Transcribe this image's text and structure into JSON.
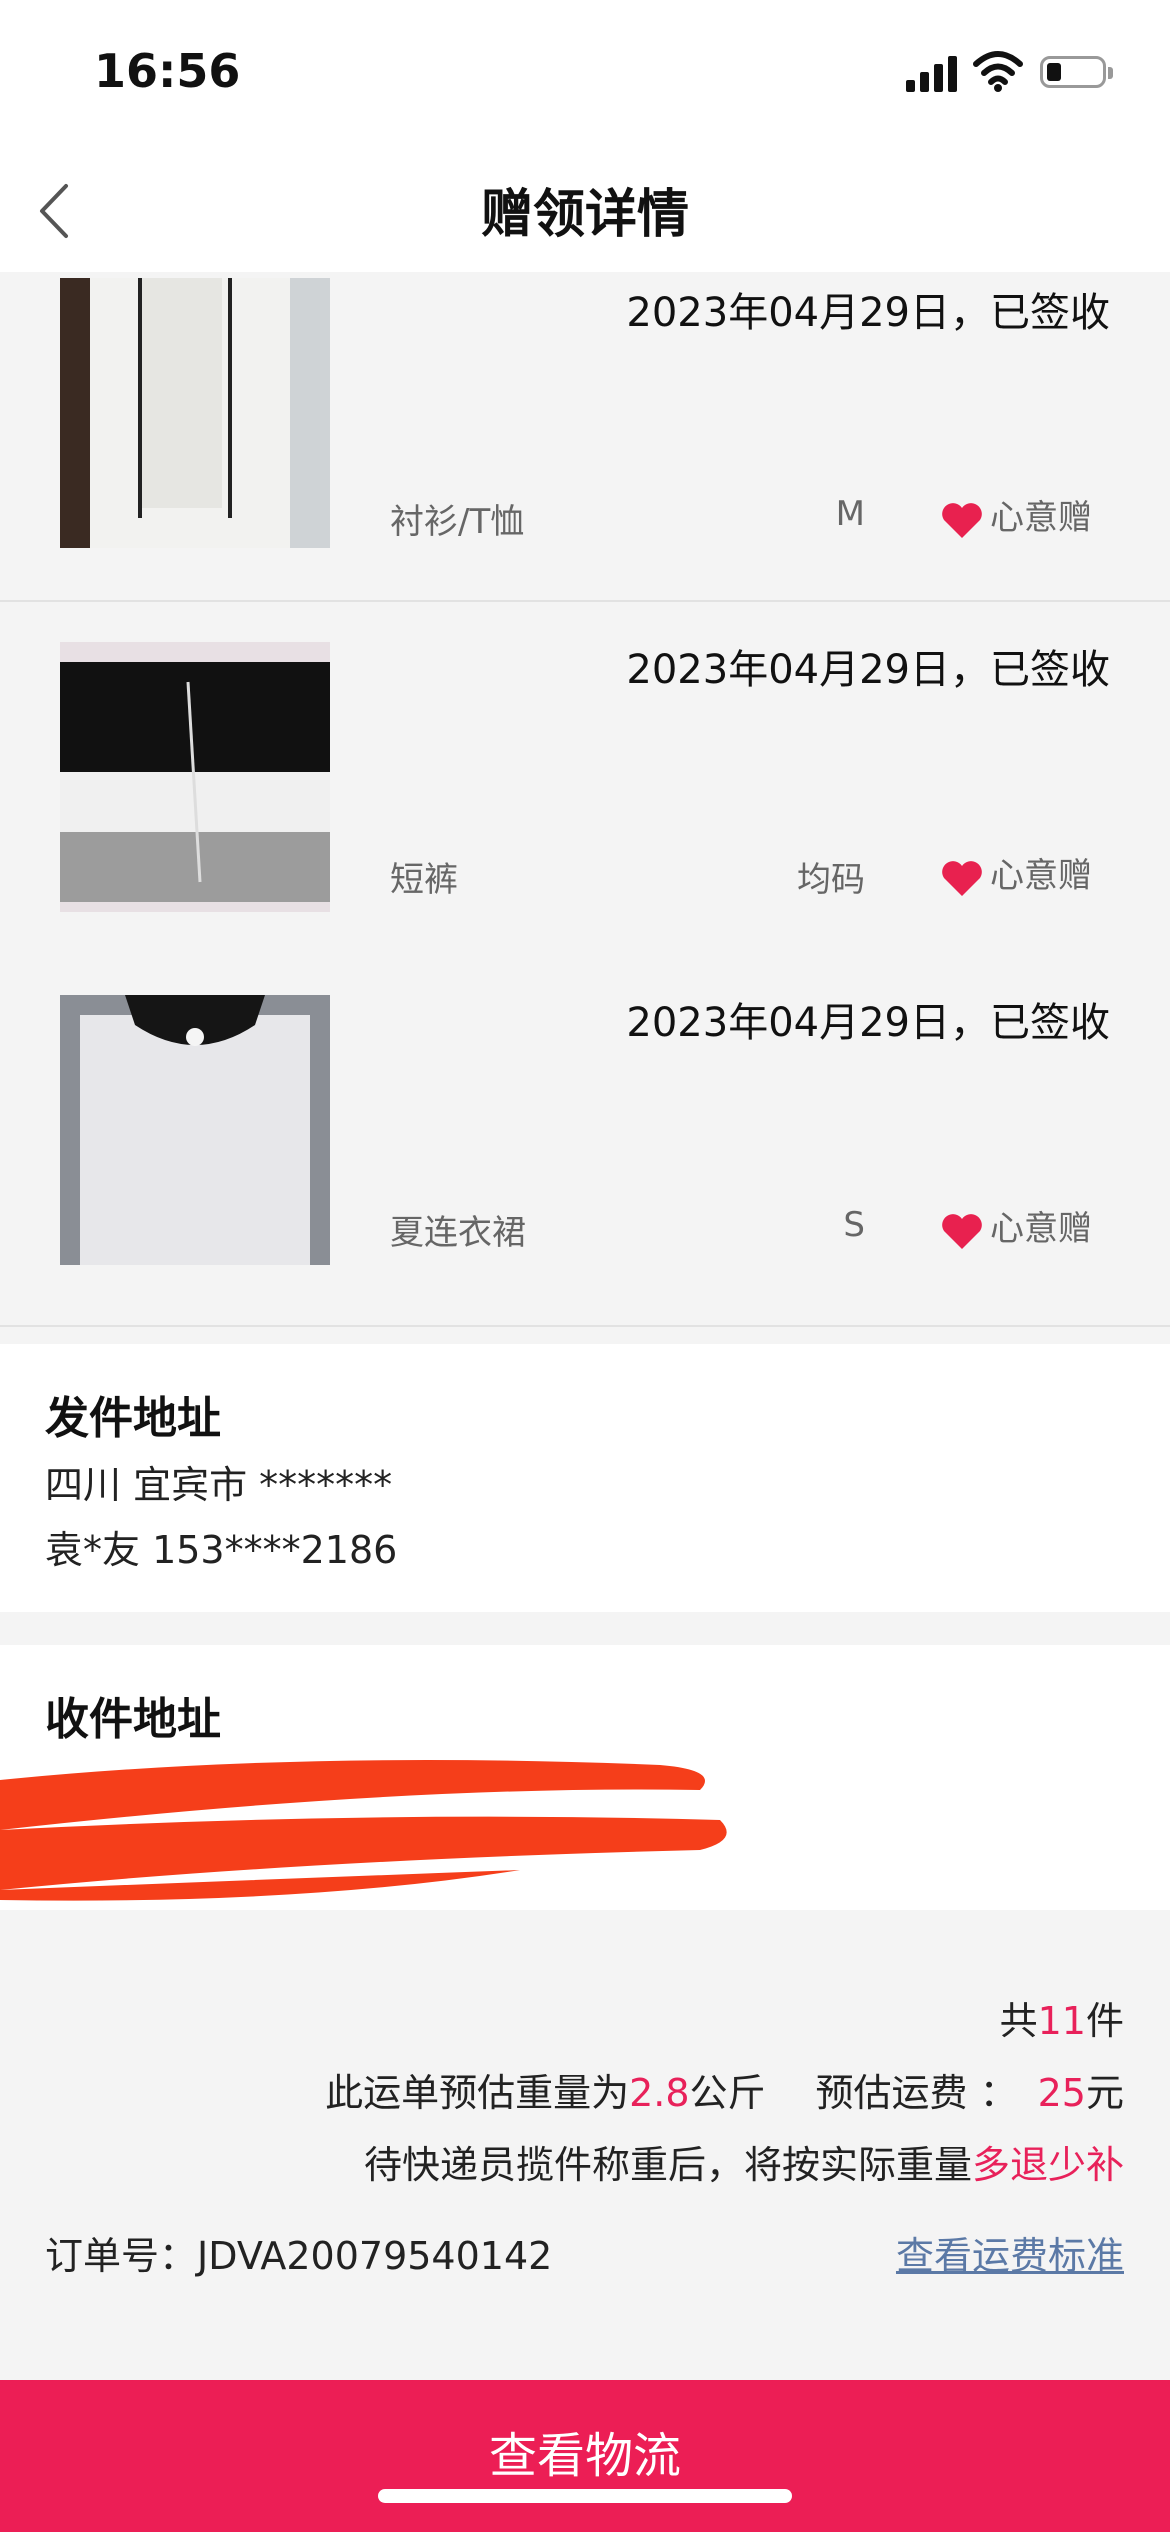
{
  "status": {
    "time": "16:56"
  },
  "nav": {
    "title": "赠领详情"
  },
  "items": [
    {
      "date": "2023年04月29日，已签收",
      "category": "衬衫/T恤",
      "size": "M",
      "badge": "心意赠"
    },
    {
      "date": "2023年04月29日，已签收",
      "category": "短裤",
      "size": "均码",
      "badge": "心意赠"
    },
    {
      "date": "2023年04月29日，已签收",
      "category": "夏连衣裙",
      "size": "S",
      "badge": "心意赠"
    }
  ],
  "sender": {
    "title": "发件地址",
    "address": "四川 宜宾市 *******",
    "contact": "袁*友 153****2186"
  },
  "receiver": {
    "title": "收件地址",
    "redacted": true
  },
  "summary": {
    "count_prefix": "共",
    "count": "11",
    "count_suffix": "件",
    "weight_prefix": "此运单预估重量为",
    "weight": "2.8",
    "weight_unit": "公斤",
    "fee_label": "预估运费 ：",
    "fee": "25",
    "fee_unit": "元",
    "note_prefix": "待快递员揽件称重后，将按实际重量",
    "note_highlight": "多退少补",
    "order_label": "订单号：",
    "order_no": "JDVA20079540142",
    "fee_link": "查看运费标准"
  },
  "cta": {
    "label": "查看物流"
  },
  "colors": {
    "accent": "#e8215a",
    "cta_bg": "#ec1e55",
    "link": "#5b79a6",
    "heart": "#e8214f"
  }
}
